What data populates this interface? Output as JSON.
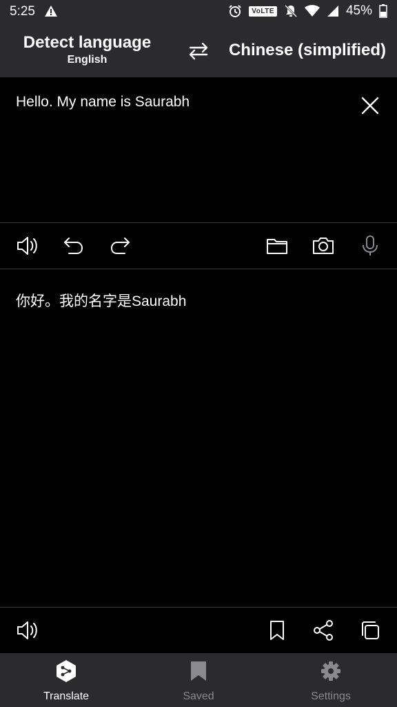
{
  "status_bar": {
    "time": "5:25",
    "volte_label": "VoLTE",
    "battery": "45%",
    "icons": [
      "warning-icon",
      "alarm-icon",
      "mute-icon",
      "wifi-icon",
      "signal-icon",
      "battery-icon"
    ]
  },
  "header": {
    "source_language": "Detect language",
    "detected_language": "English",
    "target_language": "Chinese (simplified)",
    "swap_icon": "swap-arrows-icon"
  },
  "input": {
    "text": "Hello. My name is Saurabh",
    "clear_icon": "close-icon"
  },
  "input_toolbar": {
    "icons": [
      "speaker-icon",
      "undo-icon",
      "redo-icon",
      "folder-icon",
      "camera-icon",
      "microphone-icon"
    ]
  },
  "output": {
    "text": "你好。我的名字是Saurabh"
  },
  "output_toolbar": {
    "icons": [
      "speaker-icon",
      "bookmark-icon",
      "share-icon",
      "copy-icon"
    ]
  },
  "bottom_nav": {
    "items": [
      {
        "label": "Translate",
        "icon": "translate-icon",
        "active": true
      },
      {
        "label": "Saved",
        "icon": "bookmark-icon",
        "active": false
      },
      {
        "label": "Settings",
        "icon": "gear-icon",
        "active": false
      }
    ]
  },
  "colors": {
    "bar_background": "#2b2b2e",
    "content_background": "#000000",
    "text": "#ffffff",
    "inactive": "#8a8a8e",
    "divider": "#3a3a3c"
  }
}
